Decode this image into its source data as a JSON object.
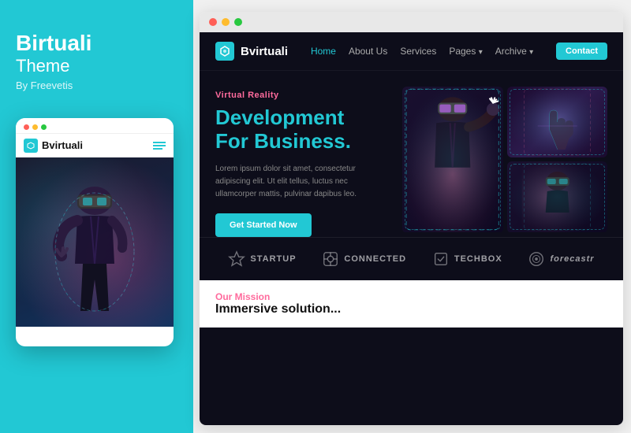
{
  "left": {
    "title": "Birtuali",
    "subtitle": "Theme",
    "by": "By Freevetis"
  },
  "browser": {
    "dots": [
      "red",
      "yellow",
      "green"
    ]
  },
  "website": {
    "logo": "Bvirtuali",
    "nav": {
      "links": [
        {
          "label": "Home",
          "active": true
        },
        {
          "label": "About Us",
          "active": false
        },
        {
          "label": "Services",
          "active": false
        },
        {
          "label": "Pages",
          "active": false,
          "arrow": true
        },
        {
          "label": "Archive",
          "active": false,
          "arrow": true
        }
      ],
      "contact_btn": "Contact"
    },
    "hero": {
      "tag": "Virtual Reality",
      "title_line1": "Development",
      "title_line2": "For Business",
      "title_dot": ".",
      "desc": "Lorem ipsum dolor sit amet, consectetur adipiscing elit. Ut elit tellus, luctus nec ullamcorper mattis, pulvinar dapibus leo.",
      "cta": "Get Started Now"
    },
    "brands": [
      {
        "label": "STARTUP"
      },
      {
        "label": "CONNECTED"
      },
      {
        "label": "TECHBOX"
      },
      {
        "label": "forecastr"
      }
    ],
    "mission": {
      "tag": "Our Mission",
      "subtitle": "Immersive solution..."
    }
  },
  "mobile": {
    "logo": "Bvirtuali"
  }
}
